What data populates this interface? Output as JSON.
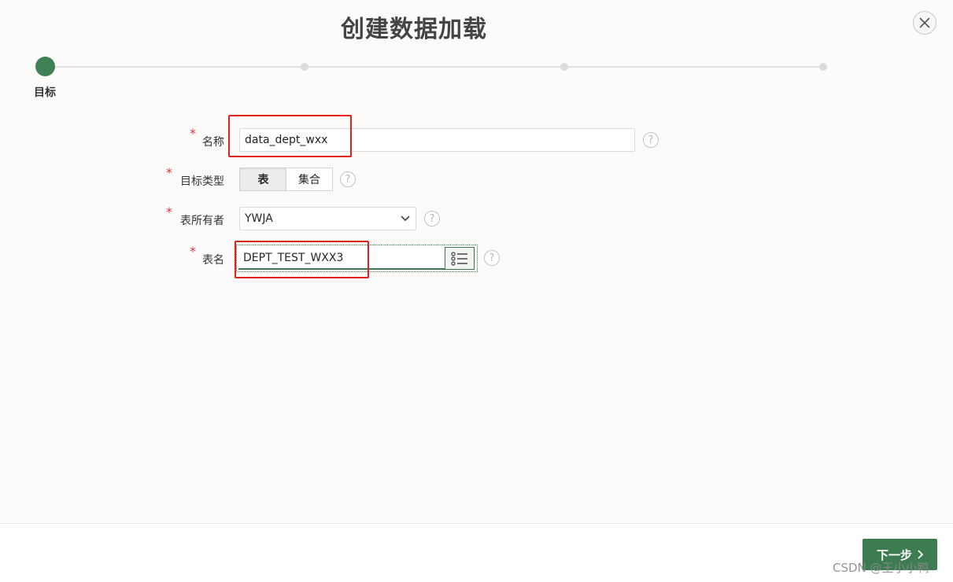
{
  "dialog": {
    "title": "创建数据加载",
    "close_icon": "close-icon"
  },
  "wizard": {
    "steps_total": 4,
    "active_index": 0,
    "active_label": "目标"
  },
  "form": {
    "name": {
      "label": "名称",
      "value": "data_dept_wxx"
    },
    "target_type": {
      "label": "目标类型",
      "options": [
        "表",
        "集合"
      ],
      "selected": "表"
    },
    "table_owner": {
      "label": "表所有者",
      "value": "YWJA"
    },
    "table_name": {
      "label": "表名",
      "value": "DEPT_TEST_WXX3"
    },
    "required_mark": "*",
    "help_glyph": "?"
  },
  "footer": {
    "next_label": "下一步"
  },
  "watermark": "CSDN @王小小鸭",
  "colors": {
    "accent": "#3c7c50",
    "highlight": "#e0221d",
    "required": "#d6383f"
  }
}
